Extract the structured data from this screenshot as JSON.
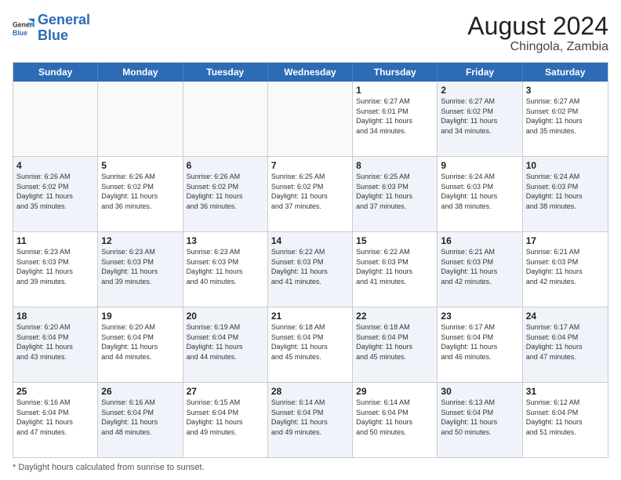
{
  "logo": {
    "text_general": "General",
    "text_blue": "Blue"
  },
  "title": "August 2024",
  "subtitle": "Chingola, Zambia",
  "header_days": [
    "Sunday",
    "Monday",
    "Tuesday",
    "Wednesday",
    "Thursday",
    "Friday",
    "Saturday"
  ],
  "footnote": "Daylight hours",
  "weeks": [
    [
      {
        "day": "",
        "info": "",
        "empty": true
      },
      {
        "day": "",
        "info": "",
        "empty": true
      },
      {
        "day": "",
        "info": "",
        "empty": true
      },
      {
        "day": "",
        "info": "",
        "empty": true
      },
      {
        "day": "1",
        "info": "Sunrise: 6:27 AM\nSunset: 6:01 PM\nDaylight: 11 hours\nand 34 minutes.",
        "empty": false,
        "alt": false
      },
      {
        "day": "2",
        "info": "Sunrise: 6:27 AM\nSunset: 6:02 PM\nDaylight: 11 hours\nand 34 minutes.",
        "empty": false,
        "alt": true
      },
      {
        "day": "3",
        "info": "Sunrise: 6:27 AM\nSunset: 6:02 PM\nDaylight: 11 hours\nand 35 minutes.",
        "empty": false,
        "alt": false
      }
    ],
    [
      {
        "day": "4",
        "info": "Sunrise: 6:26 AM\nSunset: 6:02 PM\nDaylight: 11 hours\nand 35 minutes.",
        "empty": false,
        "alt": true
      },
      {
        "day": "5",
        "info": "Sunrise: 6:26 AM\nSunset: 6:02 PM\nDaylight: 11 hours\nand 36 minutes.",
        "empty": false,
        "alt": false
      },
      {
        "day": "6",
        "info": "Sunrise: 6:26 AM\nSunset: 6:02 PM\nDaylight: 11 hours\nand 36 minutes.",
        "empty": false,
        "alt": true
      },
      {
        "day": "7",
        "info": "Sunrise: 6:25 AM\nSunset: 6:02 PM\nDaylight: 11 hours\nand 37 minutes.",
        "empty": false,
        "alt": false
      },
      {
        "day": "8",
        "info": "Sunrise: 6:25 AM\nSunset: 6:03 PM\nDaylight: 11 hours\nand 37 minutes.",
        "empty": false,
        "alt": true
      },
      {
        "day": "9",
        "info": "Sunrise: 6:24 AM\nSunset: 6:03 PM\nDaylight: 11 hours\nand 38 minutes.",
        "empty": false,
        "alt": false
      },
      {
        "day": "10",
        "info": "Sunrise: 6:24 AM\nSunset: 6:03 PM\nDaylight: 11 hours\nand 38 minutes.",
        "empty": false,
        "alt": true
      }
    ],
    [
      {
        "day": "11",
        "info": "Sunrise: 6:23 AM\nSunset: 6:03 PM\nDaylight: 11 hours\nand 39 minutes.",
        "empty": false,
        "alt": false
      },
      {
        "day": "12",
        "info": "Sunrise: 6:23 AM\nSunset: 6:03 PM\nDaylight: 11 hours\nand 39 minutes.",
        "empty": false,
        "alt": true
      },
      {
        "day": "13",
        "info": "Sunrise: 6:23 AM\nSunset: 6:03 PM\nDaylight: 11 hours\nand 40 minutes.",
        "empty": false,
        "alt": false
      },
      {
        "day": "14",
        "info": "Sunrise: 6:22 AM\nSunset: 6:03 PM\nDaylight: 11 hours\nand 41 minutes.",
        "empty": false,
        "alt": true
      },
      {
        "day": "15",
        "info": "Sunrise: 6:22 AM\nSunset: 6:03 PM\nDaylight: 11 hours\nand 41 minutes.",
        "empty": false,
        "alt": false
      },
      {
        "day": "16",
        "info": "Sunrise: 6:21 AM\nSunset: 6:03 PM\nDaylight: 11 hours\nand 42 minutes.",
        "empty": false,
        "alt": true
      },
      {
        "day": "17",
        "info": "Sunrise: 6:21 AM\nSunset: 6:03 PM\nDaylight: 11 hours\nand 42 minutes.",
        "empty": false,
        "alt": false
      }
    ],
    [
      {
        "day": "18",
        "info": "Sunrise: 6:20 AM\nSunset: 6:04 PM\nDaylight: 11 hours\nand 43 minutes.",
        "empty": false,
        "alt": true
      },
      {
        "day": "19",
        "info": "Sunrise: 6:20 AM\nSunset: 6:04 PM\nDaylight: 11 hours\nand 44 minutes.",
        "empty": false,
        "alt": false
      },
      {
        "day": "20",
        "info": "Sunrise: 6:19 AM\nSunset: 6:04 PM\nDaylight: 11 hours\nand 44 minutes.",
        "empty": false,
        "alt": true
      },
      {
        "day": "21",
        "info": "Sunrise: 6:18 AM\nSunset: 6:04 PM\nDaylight: 11 hours\nand 45 minutes.",
        "empty": false,
        "alt": false
      },
      {
        "day": "22",
        "info": "Sunrise: 6:18 AM\nSunset: 6:04 PM\nDaylight: 11 hours\nand 45 minutes.",
        "empty": false,
        "alt": true
      },
      {
        "day": "23",
        "info": "Sunrise: 6:17 AM\nSunset: 6:04 PM\nDaylight: 11 hours\nand 46 minutes.",
        "empty": false,
        "alt": false
      },
      {
        "day": "24",
        "info": "Sunrise: 6:17 AM\nSunset: 6:04 PM\nDaylight: 11 hours\nand 47 minutes.",
        "empty": false,
        "alt": true
      }
    ],
    [
      {
        "day": "25",
        "info": "Sunrise: 6:16 AM\nSunset: 6:04 PM\nDaylight: 11 hours\nand 47 minutes.",
        "empty": false,
        "alt": false
      },
      {
        "day": "26",
        "info": "Sunrise: 6:16 AM\nSunset: 6:04 PM\nDaylight: 11 hours\nand 48 minutes.",
        "empty": false,
        "alt": true
      },
      {
        "day": "27",
        "info": "Sunrise: 6:15 AM\nSunset: 6:04 PM\nDaylight: 11 hours\nand 49 minutes.",
        "empty": false,
        "alt": false
      },
      {
        "day": "28",
        "info": "Sunrise: 6:14 AM\nSunset: 6:04 PM\nDaylight: 11 hours\nand 49 minutes.",
        "empty": false,
        "alt": true
      },
      {
        "day": "29",
        "info": "Sunrise: 6:14 AM\nSunset: 6:04 PM\nDaylight: 11 hours\nand 50 minutes.",
        "empty": false,
        "alt": false
      },
      {
        "day": "30",
        "info": "Sunrise: 6:13 AM\nSunset: 6:04 PM\nDaylight: 11 hours\nand 50 minutes.",
        "empty": false,
        "alt": true
      },
      {
        "day": "31",
        "info": "Sunrise: 6:12 AM\nSunset: 6:04 PM\nDaylight: 11 hours\nand 51 minutes.",
        "empty": false,
        "alt": false
      }
    ]
  ]
}
